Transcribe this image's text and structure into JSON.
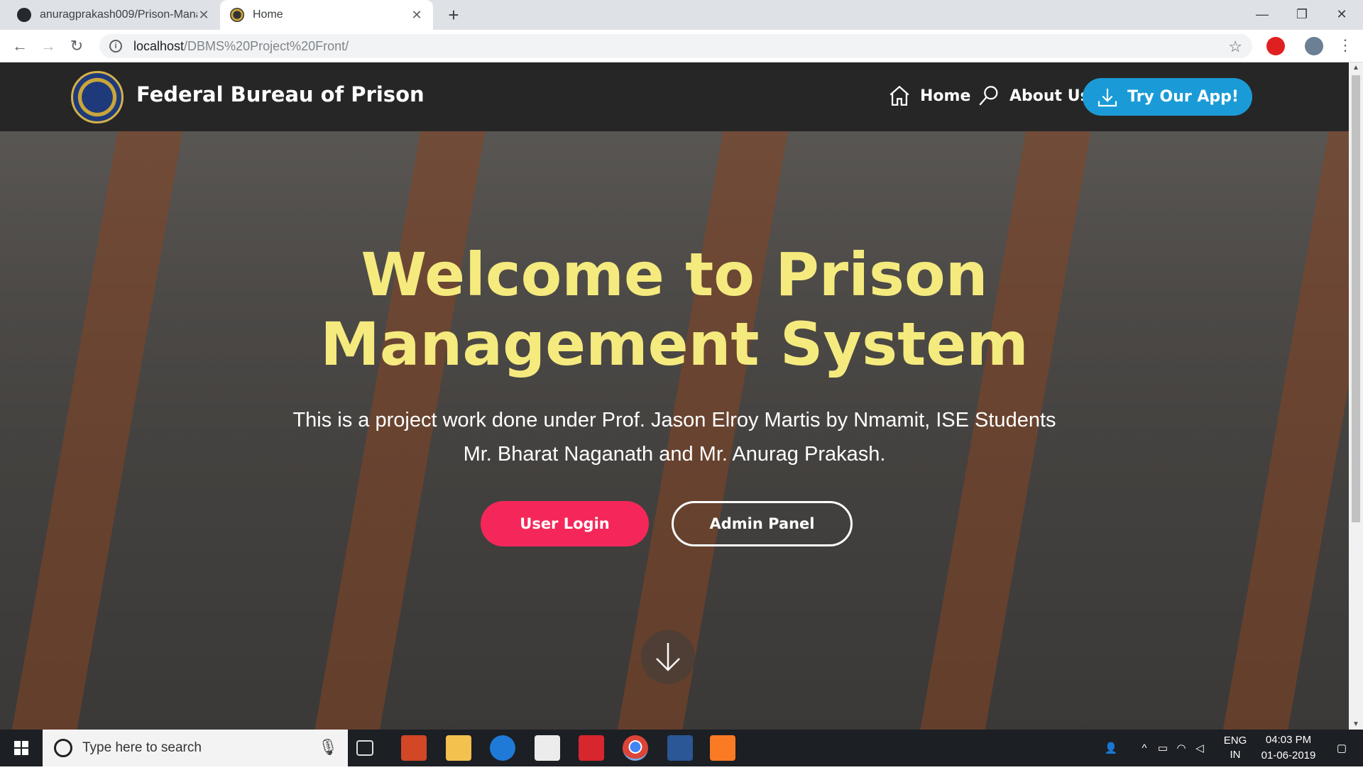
{
  "browser": {
    "tabs": [
      {
        "title": "anuragprakash009/Prison-Manag",
        "active": false
      },
      {
        "title": "Home",
        "active": true
      }
    ],
    "url_host": "localhost",
    "url_path": "/DBMS%20Project%20Front/"
  },
  "site": {
    "brand": "Federal Bureau of Prison",
    "nav": {
      "home": "Home",
      "about": "About Us",
      "cta": "Try Our App!"
    },
    "hero": {
      "headline_line1": "Welcome to Prison",
      "headline_line2": "Management System",
      "subtitle": "This is a project work done under Prof. Jason Elroy Martis by Nmamit, ISE Students Mr. Bharat Naganath and Mr. Anurag Prakash.",
      "login_button": "User Login",
      "admin_button": "Admin Panel"
    },
    "colors": {
      "headline": "#f5ea7e",
      "cta": "#1a9bd7",
      "login": "#f5275a",
      "navbar": "#262626"
    }
  },
  "taskbar": {
    "search_placeholder": "Type here to search",
    "lang_line1": "ENG",
    "lang_line2": "IN",
    "time": "04:03 PM",
    "date": "01-06-2019"
  }
}
